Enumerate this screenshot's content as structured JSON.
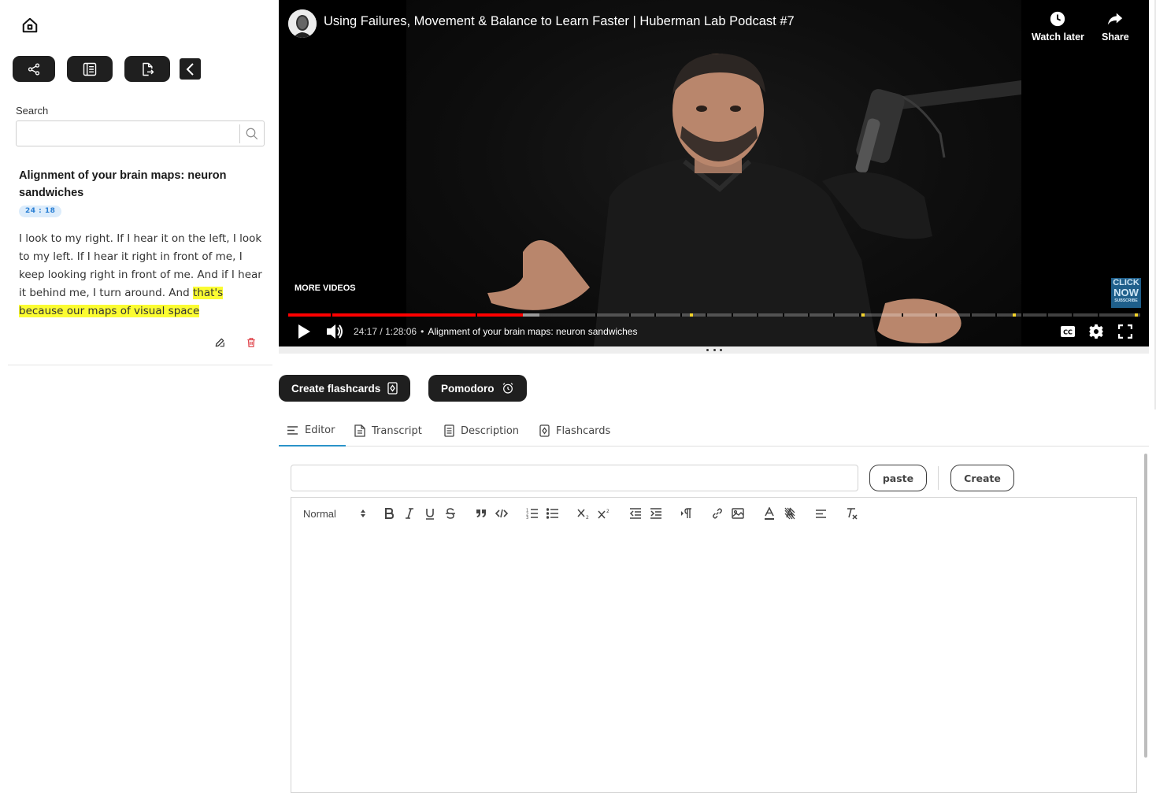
{
  "sidebar": {
    "search": {
      "label": "Search",
      "placeholder": ""
    },
    "note": {
      "title": "Alignment of your brain maps: neuron sandwiches",
      "timestamp": "24 : 18",
      "text_plain": "I look to my right. If I hear it on the left, I look to my left. If I hear it right in front of me, I keep looking right in front of me. And if I hear it behind me, I turn around. And ",
      "text_highlight": "that's because our maps of visual space"
    },
    "icons": {
      "home": "home-icon",
      "share": "share-nodes-icon",
      "notes": "notes-icon",
      "export": "export-file-icon",
      "collapse": "chevron-left-icon",
      "edit": "edit-icon",
      "delete": "trash-icon"
    },
    "colors": {
      "highlight": "#fbfc32",
      "badge_bg": "#dcecfb",
      "badge_text": "#2a7fd4",
      "delete": "#e0484f"
    }
  },
  "video": {
    "title": "Using Failures, Movement & Balance to Learn Faster | Huberman Lab Podcast #7",
    "watch_later": "Watch later",
    "share": "Share",
    "more_videos": "MORE VIDEOS",
    "click_now": {
      "line1": "CLICK",
      "line2": "NOW",
      "line3": "SUBSCRIBE"
    },
    "current_time": "24:17",
    "duration": "1:28:06",
    "time_separator": "/",
    "chapter": "Alignment of your brain maps: neuron sandwiches",
    "progress_fraction": 0.2757,
    "buffered_fraction": 0.295,
    "colors": {
      "played": "#ff0000",
      "marker": "#f2d32b"
    }
  },
  "actions": {
    "create_flashcards": "Create flashcards",
    "pomodoro": "Pomodoro"
  },
  "tabs": [
    {
      "label": "Editor",
      "active": true
    },
    {
      "label": "Transcript",
      "active": false
    },
    {
      "label": "Description",
      "active": false
    },
    {
      "label": "Flashcards",
      "active": false
    }
  ],
  "editor": {
    "title_value": "",
    "paste_label": "paste",
    "create_label": "Create",
    "format_select": "Normal",
    "accent_color": "#2a93c9"
  }
}
